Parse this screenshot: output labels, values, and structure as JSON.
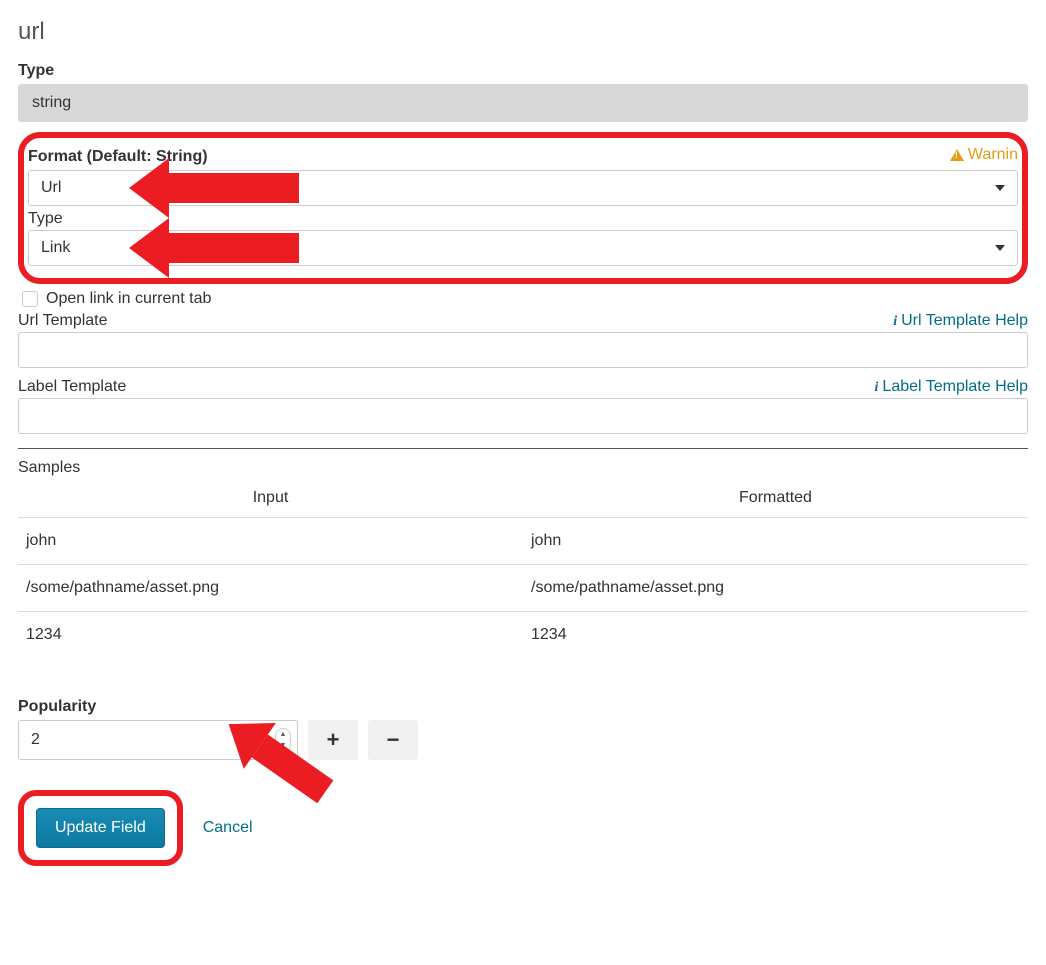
{
  "title": "url",
  "type_section": {
    "label": "Type",
    "value": "string"
  },
  "format_section": {
    "label": "Format (Default: String)",
    "warning": "Warnin",
    "select_value": "Url"
  },
  "type_select": {
    "label": "Type",
    "value": "Link"
  },
  "open_link": {
    "label": "Open link in current tab"
  },
  "url_template": {
    "label": "Url Template",
    "help": "Url Template Help",
    "value": ""
  },
  "label_template": {
    "label": "Label Template",
    "help": "Label Template Help",
    "value": ""
  },
  "samples": {
    "label": "Samples",
    "columns": {
      "input": "Input",
      "formatted": "Formatted"
    },
    "rows": [
      {
        "input": "john",
        "formatted": "john"
      },
      {
        "input": "/some/pathname/asset.png",
        "formatted": "/some/pathname/asset.png"
      },
      {
        "input": "1234",
        "formatted": "1234"
      }
    ]
  },
  "popularity": {
    "label": "Popularity",
    "value": "2"
  },
  "actions": {
    "update": "Update Field",
    "cancel": "Cancel"
  }
}
